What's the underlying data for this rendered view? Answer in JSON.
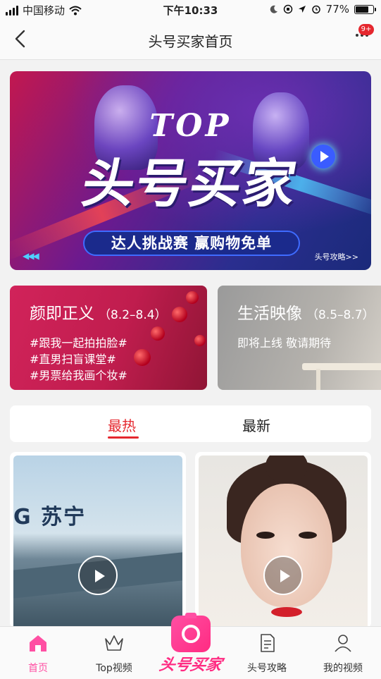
{
  "status_bar": {
    "carrier": "中国移动",
    "time": "下午10:33",
    "battery_percent": "77%",
    "battery_level": 0.77
  },
  "nav": {
    "title": "头号买家首页",
    "badge": "9+"
  },
  "banner": {
    "top_word": "TOP",
    "title": "头号买家",
    "slogan": "达人挑战赛 赢购物免单",
    "link": "头号攻略>>"
  },
  "cards": [
    {
      "title": "颜即正义",
      "dates": "（8.2–8.4）",
      "lines": [
        "#跟我一起拍拍脸#",
        "#直男扫盲课堂#",
        "#男票给我画个妆#"
      ]
    },
    {
      "title": "生活映像",
      "dates": "（8.5–8.7）",
      "subtitle": "即将上线  敬请期待"
    }
  ],
  "tabs": {
    "hot": "最热",
    "new": "最新",
    "active": "最热"
  },
  "videos": [
    {
      "thumb_text": "G 苏宁"
    },
    {
      "thumb_text": ""
    }
  ],
  "tabbar": {
    "items": [
      "首页",
      "Top视频",
      "头号买家",
      "头号攻略",
      "我的视频"
    ],
    "active": "首页"
  },
  "colors": {
    "accent": "#e5272e",
    "tab_active": "#ff4fa3",
    "center_button": "#ff2b82"
  }
}
